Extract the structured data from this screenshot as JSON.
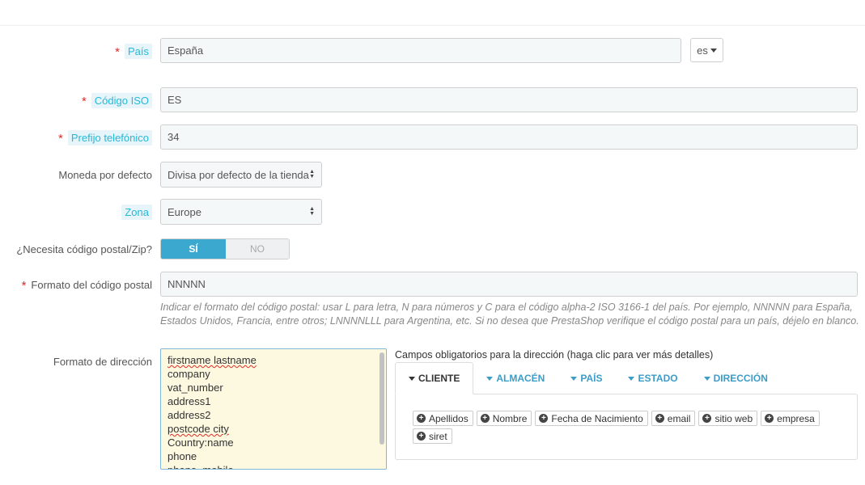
{
  "form": {
    "pais": {
      "label": "País",
      "value": "España",
      "lang": "es"
    },
    "iso": {
      "label": "Código ISO",
      "value": "ES"
    },
    "prefijo": {
      "label": "Prefijo telefónico",
      "value": "34"
    },
    "moneda": {
      "label": "Moneda por defecto",
      "value": "Divisa por defecto de la tienda"
    },
    "zona": {
      "label": "Zona",
      "value": "Europe"
    },
    "zip_needed": {
      "label": "¿Necesita código postal/Zip?",
      "yes": "SÍ",
      "no": "NO",
      "selected": "SÍ"
    },
    "zip_format": {
      "label": "Formato del código postal",
      "value": "NNNNN",
      "help_line1": "Indicar el formato del código postal: usar L para letra, N para números y C para el código alpha-2 ISO 3166-1 del país. Por ejemplo, NNNNN para España,",
      "help_line2": "Estados Unidos, Francia, entre otros; LNNNNLLL para Argentina, etc. Si no desea que PrestaShop verifique el código postal para un país, déjelo en blanco."
    },
    "address_format": {
      "label": "Formato de dirección",
      "lines": [
        "firstname lastname",
        "company",
        "vat_number",
        "address1",
        "address2",
        "postcode city",
        "Country:name",
        "phone",
        "phone_mobile"
      ]
    },
    "required_fields": {
      "title": "Campos obligatorios para la dirección (haga clic para ver más detalles)",
      "tabs": [
        "CLIENTE",
        "ALMACÉN",
        "PAÍS",
        "ESTADO",
        "DIRECCIÓN"
      ],
      "active_tab": "CLIENTE",
      "chips": [
        "Apellidos",
        "Nombre",
        "Fecha de Nacimiento",
        "email",
        "sitio web",
        "empresa",
        "siret"
      ]
    }
  },
  "colors": {
    "accent": "#25b9d7",
    "toggle_on": "#3ba8cf",
    "required": "#e02b27",
    "textarea_bg": "#fdf9e0"
  }
}
